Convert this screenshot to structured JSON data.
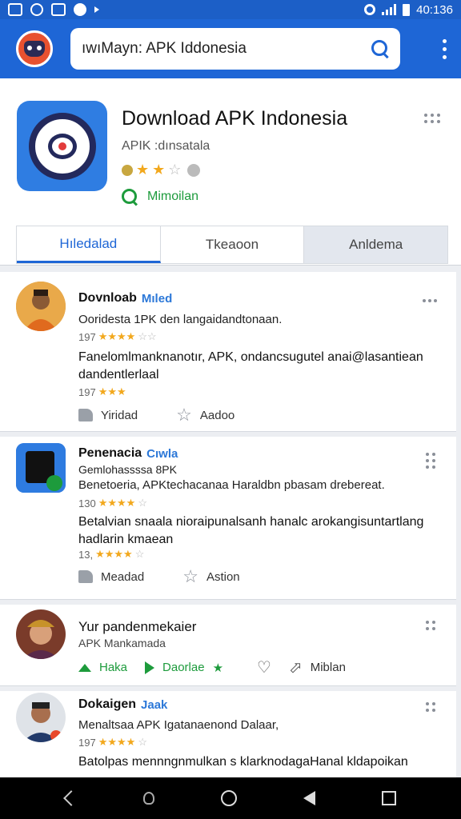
{
  "statusbar": {
    "time": "40:136"
  },
  "search": {
    "value": "ıwıMayn: APK Iddonesia"
  },
  "app": {
    "title": "Download APK Indonesia",
    "subtitle": "APIK :dınsatala",
    "install_label": "Mimoilan"
  },
  "tabs": [
    {
      "label": "Hıledalad",
      "active": true
    },
    {
      "label": "Tkeaoon",
      "active": false
    },
    {
      "label": "Anldema",
      "active": false
    }
  ],
  "posts": [
    {
      "name": "Dovnloab",
      "badge": "Mıled",
      "subtitle": "Ooridesta 1PK den langaidandtonaan.",
      "meta": "197",
      "body": "Fanelomlmanknanotır, APK, ondancsugutel anai@lasantiean dandentlerlaal",
      "actions": [
        "Yiridad",
        "Aadoo"
      ]
    },
    {
      "name": "Penenacia",
      "badge": "Cıwla",
      "subtitle": "Gemlohassssa 8PK",
      "subtitle2": "Benetoeria, APKtechacanaa Haraldbn pbasam drebereat.",
      "meta": "130",
      "body": "Betalvian snaala nioraipunalsanh hanalc arokangisuntartlang hadlarin kmaean",
      "meta2": "13,",
      "actions": [
        "Meadad",
        "Astion"
      ]
    },
    {
      "name": "Yur pandenmekaier",
      "subtitle": "APK Mankamada",
      "actions": [
        "Haka",
        "Daorlae",
        "Miblan"
      ]
    },
    {
      "name": "Dokaigen",
      "badge": "Jaak",
      "subtitle": "Menaltsaa APK Igatanaenond Dalaar,",
      "meta": "197",
      "body": "Batolpas mennngnmulkan s klarknodagaHanal kldapoikan"
    }
  ]
}
